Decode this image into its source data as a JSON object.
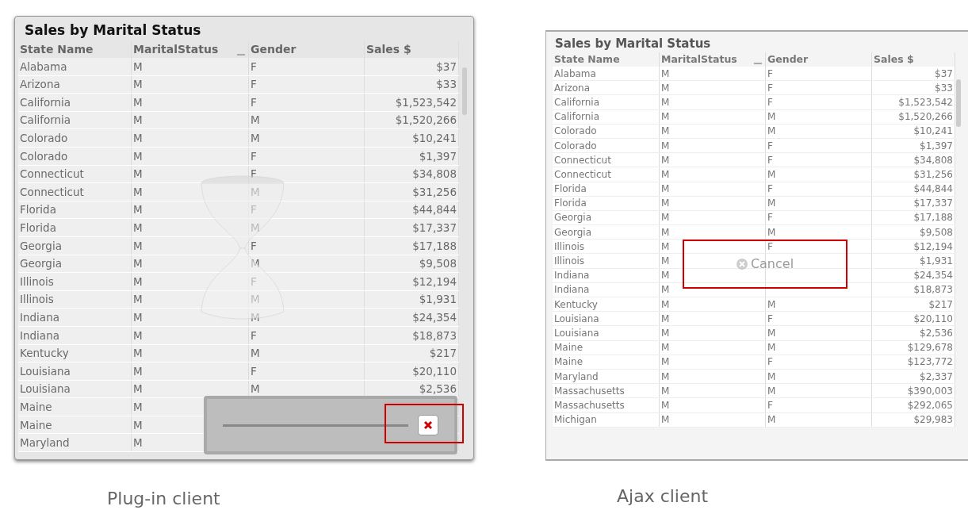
{
  "panels": [
    {
      "kind": "plugin",
      "title": "Sales by Marital Status",
      "columns": [
        "State Name",
        "MaritalStatus",
        "Gender",
        "Sales $"
      ],
      "rows": [
        [
          "Alabama",
          "M",
          "F",
          "$37"
        ],
        [
          "Arizona",
          "M",
          "F",
          "$33"
        ],
        [
          "California",
          "M",
          "F",
          "$1,523,542"
        ],
        [
          "California",
          "M",
          "M",
          "$1,520,266"
        ],
        [
          "Colorado",
          "M",
          "M",
          "$10,241"
        ],
        [
          "Colorado",
          "M",
          "F",
          "$1,397"
        ],
        [
          "Connecticut",
          "M",
          "F",
          "$34,808"
        ],
        [
          "Connecticut",
          "M",
          "M",
          "$31,256"
        ],
        [
          "Florida",
          "M",
          "F",
          "$44,844"
        ],
        [
          "Florida",
          "M",
          "M",
          "$17,337"
        ],
        [
          "Georgia",
          "M",
          "F",
          "$17,188"
        ],
        [
          "Georgia",
          "M",
          "M",
          "$9,508"
        ],
        [
          "Illinois",
          "M",
          "F",
          "$12,194"
        ],
        [
          "Illinois",
          "M",
          "M",
          "$1,931"
        ],
        [
          "Indiana",
          "M",
          "M",
          "$24,354"
        ],
        [
          "Indiana",
          "M",
          "F",
          "$18,873"
        ],
        [
          "Kentucky",
          "M",
          "M",
          "$217"
        ],
        [
          "Louisiana",
          "M",
          "F",
          "$20,110"
        ],
        [
          "Louisiana",
          "M",
          "M",
          "$2,536"
        ],
        [
          "Maine",
          "M"
        ],
        [
          "Maine",
          "M"
        ],
        [
          "Maryland",
          "M"
        ]
      ],
      "overlay": {
        "kind": "progress"
      },
      "caption": "Plug-in client"
    },
    {
      "kind": "ajax",
      "title": "Sales by Marital Status",
      "columns": [
        "State Name",
        "MaritalStatus",
        "Gender",
        "Sales $"
      ],
      "rows": [
        [
          "Alabama",
          "M",
          "F",
          "$37"
        ],
        [
          "Arizona",
          "M",
          "F",
          "$33"
        ],
        [
          "California",
          "M",
          "F",
          "$1,523,542"
        ],
        [
          "California",
          "M",
          "M",
          "$1,520,266"
        ],
        [
          "Colorado",
          "M",
          "M",
          "$10,241"
        ],
        [
          "Colorado",
          "M",
          "F",
          "$1,397"
        ],
        [
          "Connecticut",
          "M",
          "F",
          "$34,808"
        ],
        [
          "Connecticut",
          "M",
          "M",
          "$31,256"
        ],
        [
          "Florida",
          "M",
          "F",
          "$44,844"
        ],
        [
          "Florida",
          "M",
          "M",
          "$17,337"
        ],
        [
          "Georgia",
          "M",
          "F",
          "$17,188"
        ],
        [
          "Georgia",
          "M",
          "M",
          "$9,508"
        ],
        [
          "Illinois",
          "M",
          "F",
          "$12,194"
        ],
        [
          "Illinois",
          "M",
          "",
          "$1,931"
        ],
        [
          "Indiana",
          "M",
          "",
          "$24,354"
        ],
        [
          "Indiana",
          "M",
          "",
          "$18,873"
        ],
        [
          "Kentucky",
          "M",
          "M",
          "$217"
        ],
        [
          "Louisiana",
          "M",
          "F",
          "$20,110"
        ],
        [
          "Louisiana",
          "M",
          "M",
          "$2,536"
        ],
        [
          "Maine",
          "M",
          "M",
          "$129,678"
        ],
        [
          "Maine",
          "M",
          "F",
          "$123,772"
        ],
        [
          "Maryland",
          "M",
          "M",
          "$2,337"
        ],
        [
          "Massachusetts",
          "M",
          "M",
          "$390,003"
        ],
        [
          "Massachusetts",
          "M",
          "F",
          "$292,065"
        ],
        [
          "Michigan",
          "M",
          "M",
          "$29,983"
        ]
      ],
      "overlay": {
        "kind": "cancel",
        "label": "Cancel"
      },
      "caption": "Ajax client"
    }
  ]
}
